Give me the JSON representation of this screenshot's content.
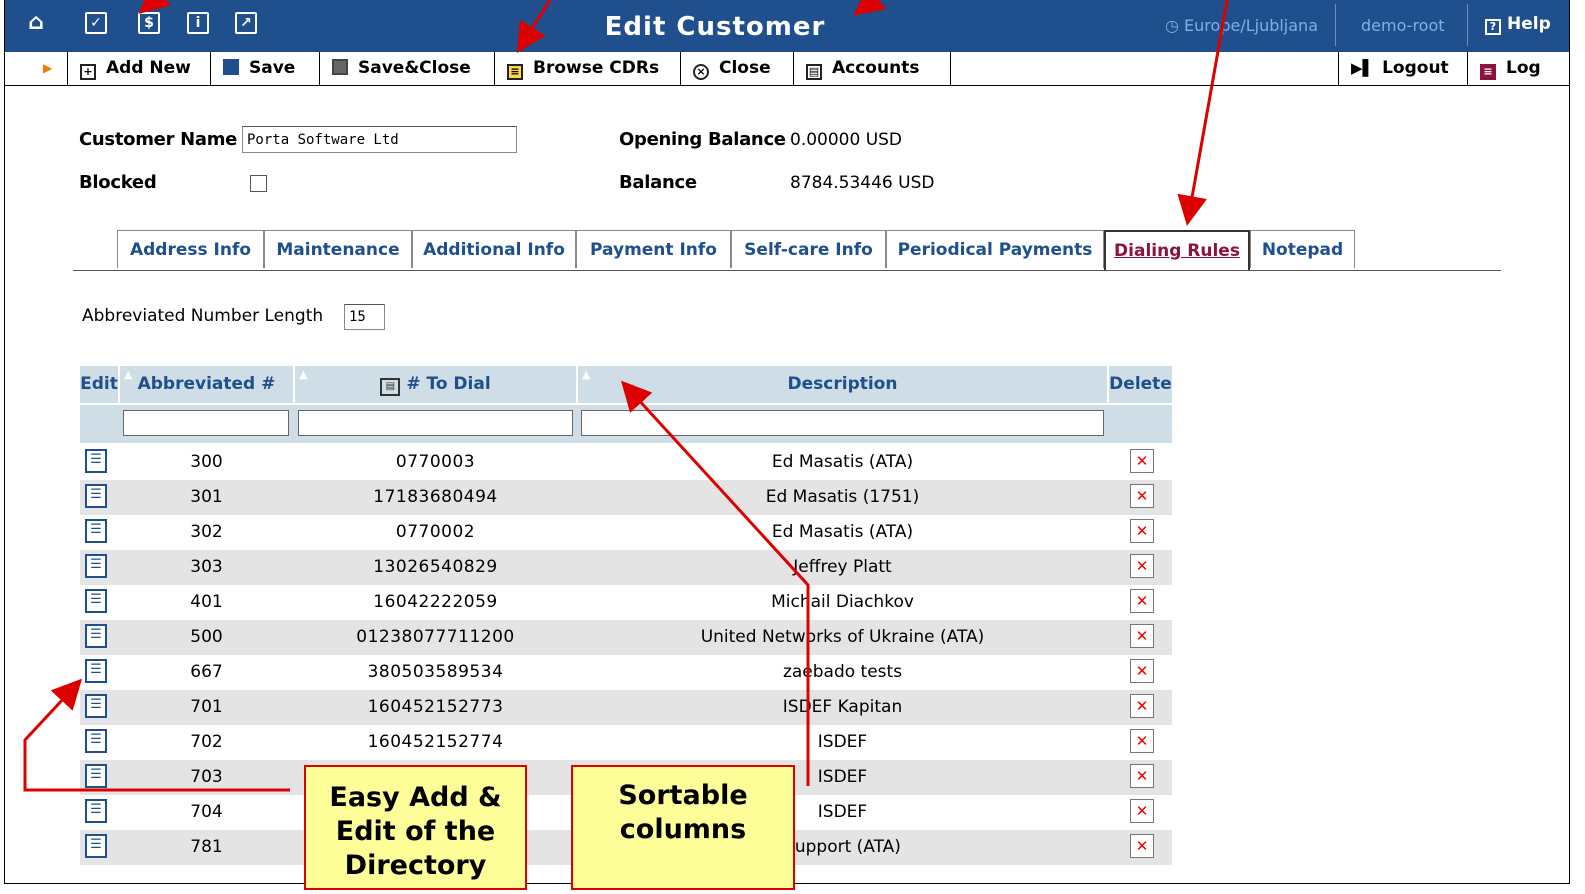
{
  "titlebar": {
    "title": "Edit Customer",
    "timezone": "Europe/Ljubljana",
    "user": "demo-root",
    "help": "Help",
    "icons": [
      "home-icon",
      "check-icon",
      "dollar-icon",
      "info-icon",
      "chart-icon"
    ]
  },
  "toolbar": {
    "add_new": "Add New",
    "save": "Save",
    "save_close": "Save&Close",
    "browse_cdrs": "Browse CDRs",
    "close": "Close",
    "accounts": "Accounts",
    "logout": "Logout",
    "log": "Log"
  },
  "customer": {
    "name_label": "Customer Name",
    "name_value": "Porta Software Ltd",
    "blocked_label": "Blocked",
    "opening_balance_label": "Opening Balance",
    "opening_balance_value": "0.00000 USD",
    "balance_label": "Balance",
    "balance_value": "8784.53446 USD"
  },
  "tabs": [
    "Address Info",
    "Maintenance",
    "Additional Info",
    "Payment Info",
    "Self-care Info",
    "Periodical Payments",
    "Dialing Rules",
    "Notepad"
  ],
  "active_tab": "Dialing Rules",
  "abbrev": {
    "label": "Abbreviated Number Length",
    "value": "15"
  },
  "table": {
    "headers": {
      "edit": "Edit",
      "abbreviated": "Abbreviated #",
      "to_dial": "# To Dial",
      "description": "Description",
      "delete": "Delete"
    },
    "rows": [
      {
        "abbr": "300",
        "dial": "0770003",
        "desc": "Ed Masatis (ATA)"
      },
      {
        "abbr": "301",
        "dial": "17183680494",
        "desc": "Ed Masatis (1751)"
      },
      {
        "abbr": "302",
        "dial": "0770002",
        "desc": "Ed Masatis (ATA)"
      },
      {
        "abbr": "303",
        "dial": "13026540829",
        "desc": "Jeffrey Platt"
      },
      {
        "abbr": "401",
        "dial": "16042222059",
        "desc": "Michail Diachkov"
      },
      {
        "abbr": "500",
        "dial": "01238077711200",
        "desc": "United Networks of Ukraine (ATA)"
      },
      {
        "abbr": "667",
        "dial": "380503589534",
        "desc": "zaebado tests"
      },
      {
        "abbr": "701",
        "dial": "160452152773",
        "desc": "ISDEF Kapitan"
      },
      {
        "abbr": "702",
        "dial": "160452152774",
        "desc": "ISDEF"
      },
      {
        "abbr": "703",
        "dial": "",
        "desc": "ISDEF"
      },
      {
        "abbr": "704",
        "dial": "",
        "desc": "ISDEF"
      },
      {
        "abbr": "781",
        "dial": "",
        "desc": "Support (ATA)"
      }
    ]
  },
  "callouts": {
    "edit": "Easy Add & Edit of the Directory",
    "sortable": "Sortable columns"
  },
  "colors": {
    "header_blue": "#1f4f8c",
    "table_header": "#cfdde6",
    "active_tab": "#8b1538",
    "callout_fill": "#ffff99",
    "arrow_red": "#dd0000"
  }
}
